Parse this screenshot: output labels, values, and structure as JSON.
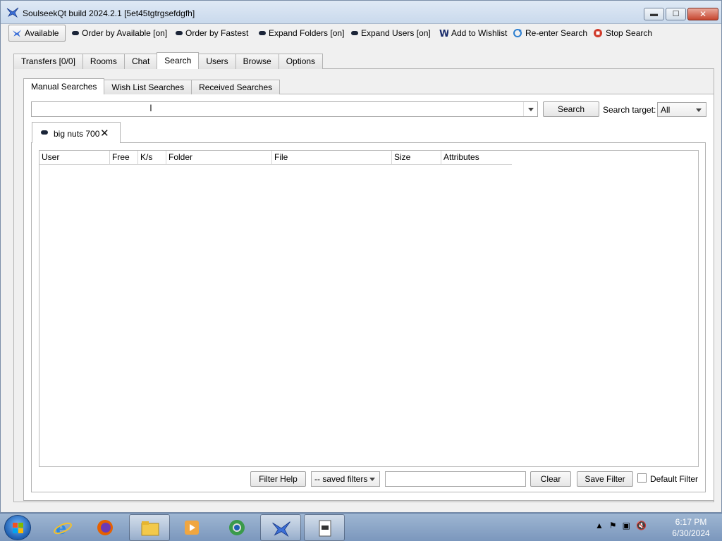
{
  "window": {
    "title": "SoulseekQt build 2024.2.1 [5et45tgtrgsefdgfh]"
  },
  "toolbar": {
    "available": "Available",
    "order_available": "Order by Available [on]",
    "order_fastest": "Order by Fastest",
    "expand_folders": "Expand Folders [on]",
    "expand_users": "Expand Users [on]",
    "add_wishlist": "Add to Wishlist",
    "reenter_search": "Re-enter Search",
    "stop_search": "Stop Search"
  },
  "main_tabs": [
    "Transfers [0/0]",
    "Rooms",
    "Chat",
    "Search",
    "Users",
    "Browse",
    "Options"
  ],
  "main_tab_active": "Search",
  "sub_tabs": [
    "Manual Searches",
    "Wish List Searches",
    "Received Searches"
  ],
  "sub_tab_active": "Manual Searches",
  "search": {
    "query_value": "",
    "button": "Search",
    "target_label": "Search target:",
    "target_value": "All"
  },
  "result_tab": {
    "label": "big nuts 700",
    "close_glyph": "✕"
  },
  "table": {
    "columns": [
      "User",
      "Free",
      "K/s",
      "Folder",
      "File",
      "Size",
      "Attributes"
    ],
    "rows": []
  },
  "filter": {
    "help_button": "Filter Help",
    "saved_filters": "-- saved filters",
    "filter_value": "",
    "clear_button": "Clear",
    "save_button": "Save Filter",
    "default_label": "Default Filter",
    "default_checked": false
  },
  "taskbar": {
    "time": "6:17 PM",
    "date": "6/30/2024"
  },
  "colors": {
    "taskbar": "#7b97bd",
    "titlebar": "#c9d9ec",
    "close_button": "#c7462f"
  }
}
